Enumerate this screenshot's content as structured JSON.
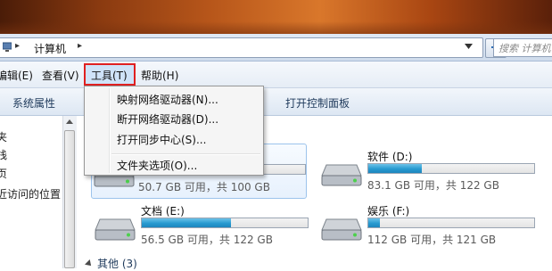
{
  "address": {
    "crumb": "计算机",
    "separator": "▸"
  },
  "search": {
    "placeholder": "搜索 计算机"
  },
  "menubar": {
    "edit": "编辑(E)",
    "view": "查看(V)",
    "tools": "工具(T)",
    "help": "帮助(H)"
  },
  "toolbar": {
    "system_properties": "系统属性",
    "open_control_panel": "打开控制面板"
  },
  "nav": {
    "items": [
      "夹",
      "栈",
      "页",
      "近访问的位置"
    ]
  },
  "tools_menu": {
    "items": [
      "映射网络驱动器(N)...",
      "断开网络驱动器(D)...",
      "打开同步中心(S)...",
      "文件夹选项(O)..."
    ]
  },
  "drives": [
    {
      "name": "",
      "info": "50.7 GB 可用，共 100 GB",
      "used_fraction": 0.49
    },
    {
      "name": "软件 (D:)",
      "info": "83.1 GB 可用，共 122 GB",
      "used_fraction": 0.32
    },
    {
      "name": "文档 (E:)",
      "info": "56.5 GB 可用，共 122 GB",
      "used_fraction": 0.54
    },
    {
      "name": "娱乐 (F:)",
      "info": "112 GB 可用，共 121 GB",
      "used_fraction": 0.07
    }
  ],
  "group": {
    "other": "其他 (3)"
  },
  "colors": {
    "highlight_border": "#e02020",
    "drive_bar": "#279ad0"
  }
}
